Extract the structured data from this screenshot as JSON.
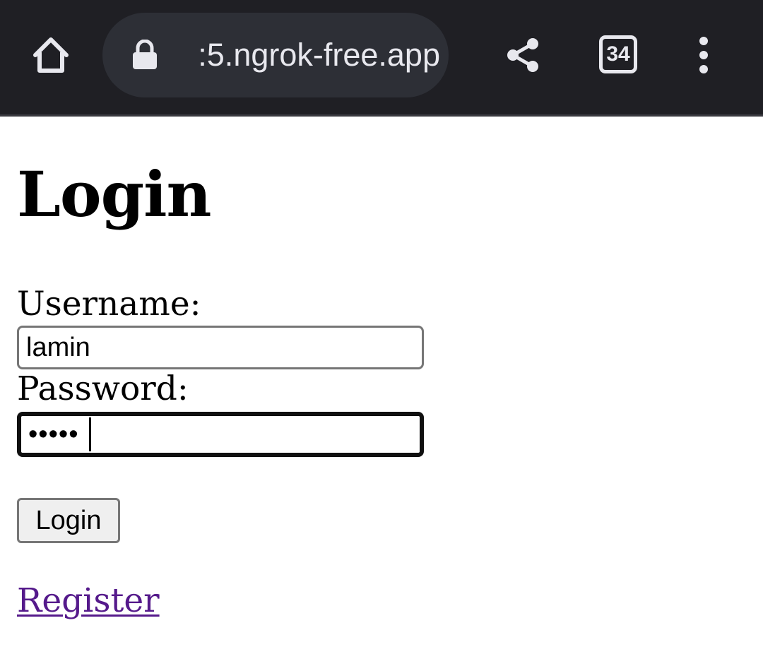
{
  "browser": {
    "url_visible": ":5.ngrok-free.app",
    "tab_count": "34",
    "colors": {
      "toolbar": "#1f1f24",
      "omnibox": "#2d2f36",
      "icon": "#e8e8ee"
    },
    "icons": [
      "home-icon",
      "lock-icon",
      "share-icon",
      "tabs-icon",
      "more-vert-icon"
    ]
  },
  "page": {
    "title": "Login",
    "username_label": "Username:",
    "username_value": "lamin",
    "password_label": "Password:",
    "password_value": "•••••",
    "login_button": "Login",
    "register_link": "Register",
    "link_color": "#551a8b"
  }
}
